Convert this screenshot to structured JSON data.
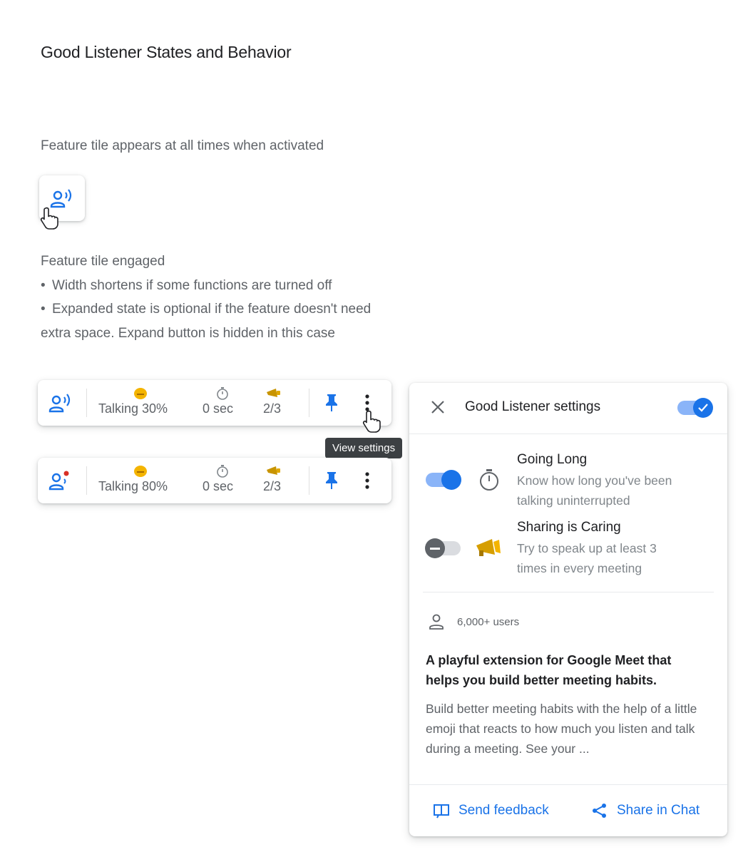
{
  "page": {
    "title": "Good Listener States and Behavior",
    "caption_activated": "Feature tile appears at all times when activated",
    "engaged": {
      "heading": "Feature tile engaged",
      "bullet1": "Width shortens if some functions are turned off",
      "bullet2": "Expanded state is optional if the feature doesn't need",
      "bullet2_cont": "extra space. Expand button is hidden in this case"
    }
  },
  "bars": [
    {
      "talking": "Talking 30%",
      "time": "0 sec",
      "count": "2/3"
    },
    {
      "talking": "Talking 80%",
      "time": "0 sec",
      "count": "2/3"
    }
  ],
  "tooltip": "View settings",
  "settings": {
    "title": "Good Listener settings",
    "master_enabled": true,
    "features": [
      {
        "title": "Going Long",
        "desc1": "Know how long you've been",
        "desc2": "talking uninterrupted",
        "enabled": true
      },
      {
        "title": "Sharing is Caring",
        "desc1": "Try to speak up at least 3",
        "desc2": "times in every meeting",
        "enabled": false
      }
    ],
    "users": "6,000+ users",
    "tagline": "A playful extension for Google Meet that helps you build better meeting habits.",
    "description": "Build better meeting habits with the help of a little emoji that reacts to how much you listen and talk during a meeting. See your ...",
    "feedback": "Send feedback",
    "share": "Share in Chat"
  },
  "colors": {
    "accent": "#1a73e8",
    "emoji": "#f4b400"
  }
}
